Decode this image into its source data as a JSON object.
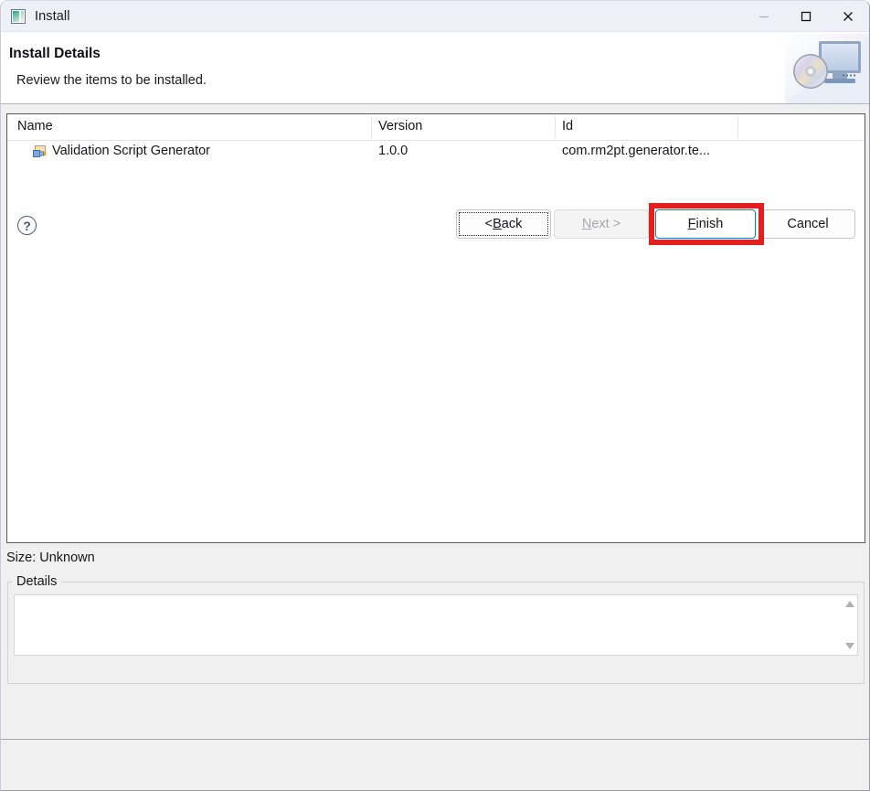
{
  "window": {
    "title": "Install",
    "icon": "install-window-icon",
    "controls": {
      "minimize": "minimize-icon",
      "maximize": "maximize-icon",
      "close": "close-icon"
    }
  },
  "header": {
    "title": "Install Details",
    "subtitle": "Review the items to be installed.",
    "artwork": "cd-and-monitor-install-icon"
  },
  "table": {
    "columns": [
      "Name",
      "Version",
      "Id"
    ],
    "rows": [
      {
        "name": "Validation Script Generator",
        "version": "1.0.0",
        "id": "com.rm2pt.generator.te...",
        "icon": "eclipse-feature-icon"
      }
    ]
  },
  "size_label": "Size: Unknown",
  "details": {
    "group_label": "Details",
    "content": "",
    "scroll_up": "scroll-up-arrow",
    "scroll_down": "scroll-down-arrow"
  },
  "buttons": {
    "help": "?",
    "back": {
      "prefix": "< ",
      "mnemonic": "B",
      "suffix": "ack"
    },
    "next": {
      "mnemonic": "N",
      "suffix": "ext >"
    },
    "finish": {
      "mnemonic": "F",
      "suffix": "inish"
    },
    "cancel": {
      "label": "Cancel"
    }
  },
  "annotation": {
    "color": "#e41f1f",
    "target": "finish-button"
  }
}
